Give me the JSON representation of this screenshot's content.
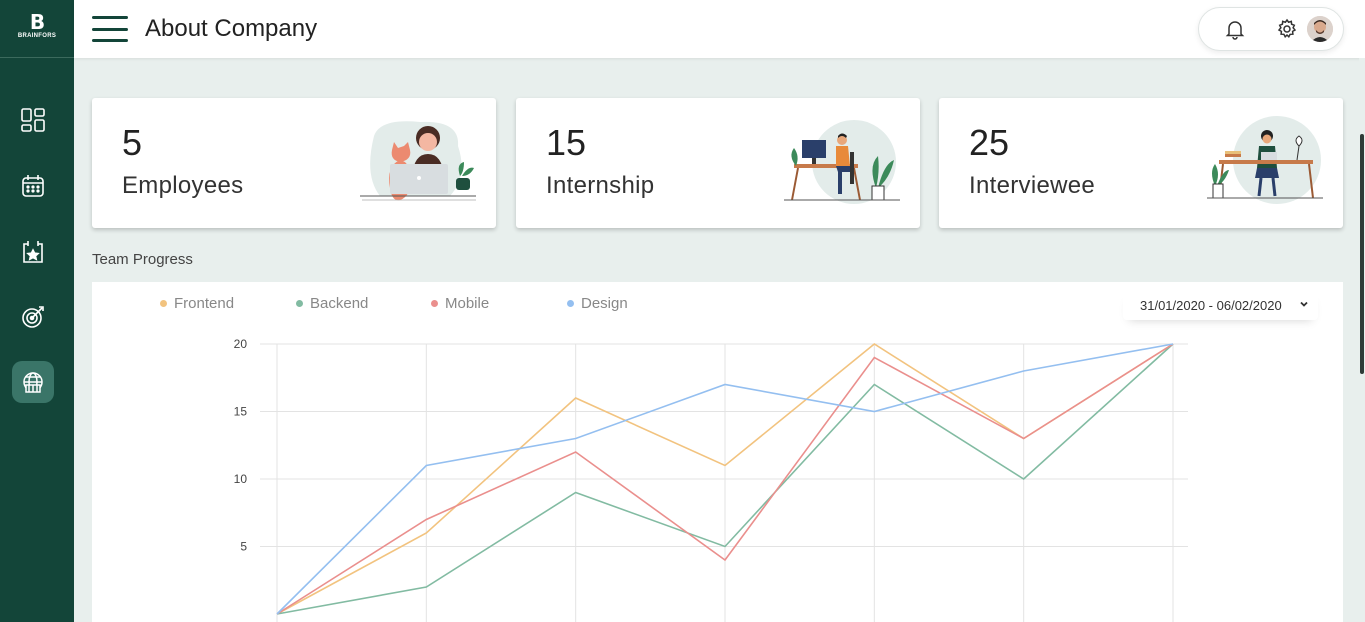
{
  "brand": {
    "logo_mark": "B",
    "logo_text": "BRAINFORS"
  },
  "header": {
    "title": "About Company"
  },
  "sidebar": {
    "items": [
      {
        "icon": "dashboard-icon",
        "active": false
      },
      {
        "icon": "calendar-icon",
        "active": false
      },
      {
        "icon": "calendar-star-icon",
        "active": false
      },
      {
        "icon": "target-icon",
        "active": false
      },
      {
        "icon": "company-globe-icon",
        "active": true
      }
    ]
  },
  "stats": [
    {
      "value": "5",
      "label": "Employees",
      "illustration": "woman-laptop-cat-illustration"
    },
    {
      "value": "15",
      "label": "Internship",
      "illustration": "man-desk-computer-illustration"
    },
    {
      "value": "25",
      "label": "Interviewee",
      "illustration": "woman-desk-laptop-illustration"
    }
  ],
  "section": {
    "title": "Team Progress"
  },
  "date_range": {
    "value": "31/01/2020 - 06/02/2020"
  },
  "colors": {
    "sidebar": "#134539",
    "frontend": "#f2c37f",
    "backend": "#82bba2",
    "mobile": "#ea8f8d",
    "design": "#94bff0"
  },
  "chart_data": {
    "type": "line",
    "x": [
      0,
      1,
      2,
      3,
      4,
      5,
      6
    ],
    "ylim": [
      0,
      20
    ],
    "yticks": [
      "5",
      "10",
      "15",
      "20"
    ],
    "grid": true,
    "legend_position": "top-left",
    "series": [
      {
        "name": "Frontend",
        "color": "#f2c37f",
        "values": [
          0,
          6,
          16,
          11,
          20,
          13,
          20
        ]
      },
      {
        "name": "Backend",
        "color": "#82bba2",
        "values": [
          0,
          2,
          9,
          5,
          17,
          10,
          20
        ]
      },
      {
        "name": "Mobile",
        "color": "#ea8f8d",
        "values": [
          0,
          7,
          12,
          4,
          19,
          13,
          20
        ]
      },
      {
        "name": "Design",
        "color": "#94bff0",
        "values": [
          0,
          11,
          13,
          17,
          15,
          18,
          20
        ]
      }
    ]
  }
}
